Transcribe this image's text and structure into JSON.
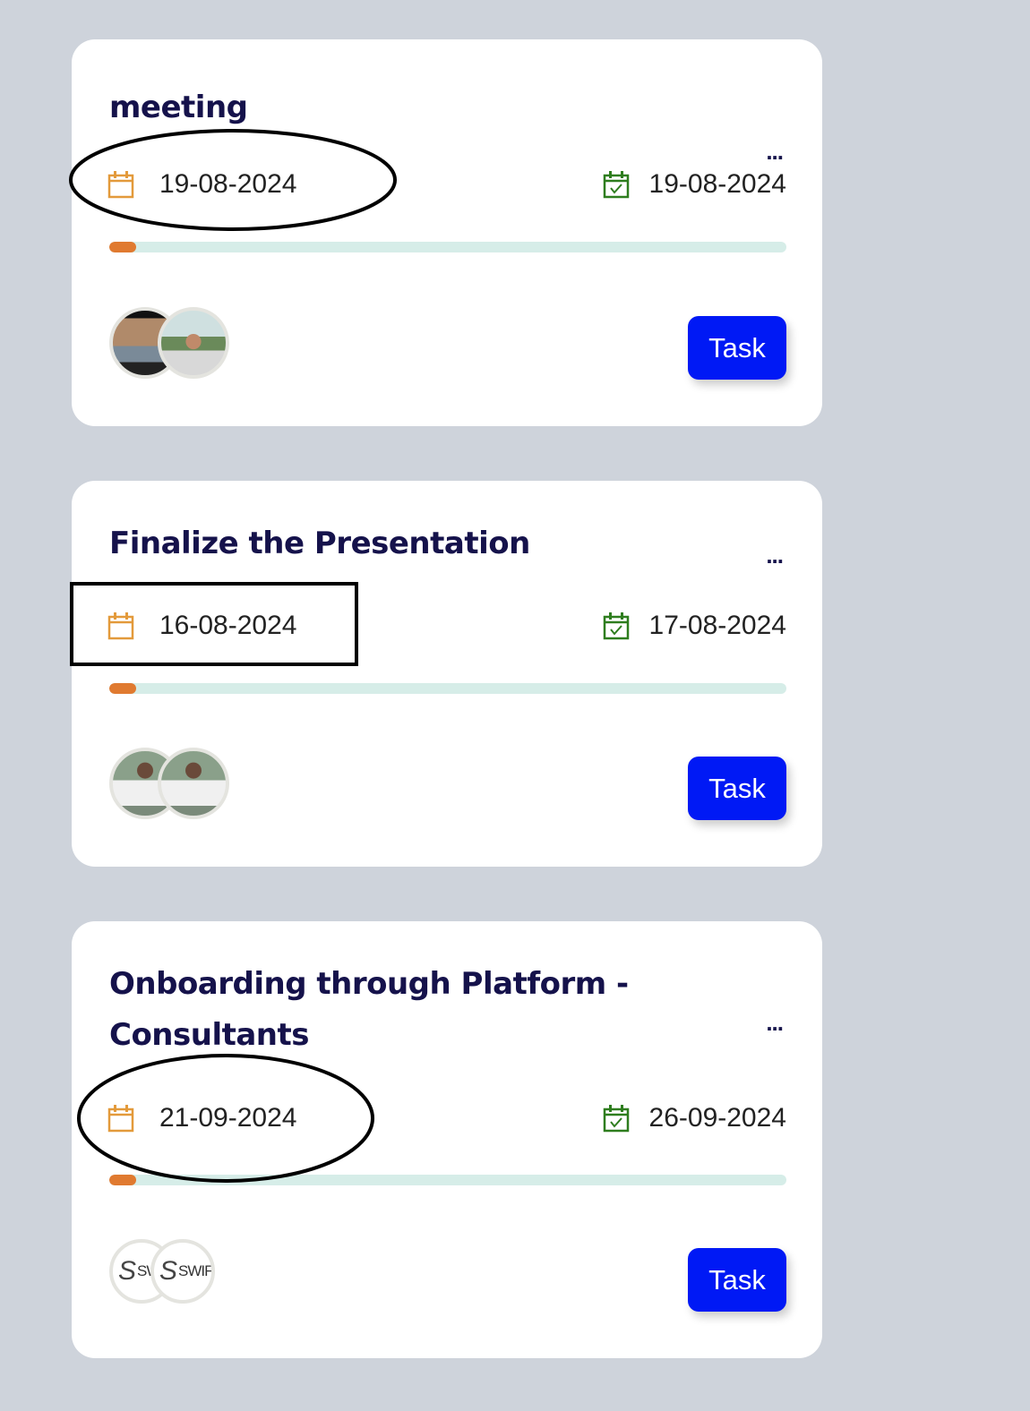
{
  "colors": {
    "title": "#15124b",
    "start_icon": "#e39a3b",
    "end_icon": "#2e7d1e",
    "progress_fill": "#e07a30",
    "progress_track": "#d6ede8",
    "task_button": "#0019f5",
    "background": "#ced3db"
  },
  "cards": [
    {
      "title": "meeting",
      "more": "...",
      "start_date": "19-08-2024",
      "end_date": "19-08-2024",
      "progress_percent": 4,
      "avatars": [
        "photo",
        "photo"
      ],
      "button": "Task",
      "annotation": "ellipse"
    },
    {
      "title": "Finalize the Presentation",
      "more": "...",
      "start_date": "16-08-2024",
      "end_date": "17-08-2024",
      "progress_percent": 4,
      "avatars": [
        "photo",
        "photo"
      ],
      "button": "Task",
      "annotation": "rectangle"
    },
    {
      "title": "Onboarding through Platform - Consultants",
      "more": "...",
      "start_date": "21-09-2024",
      "end_date": "26-09-2024",
      "progress_percent": 4,
      "avatars": [
        "SWIFTERZ logo",
        "SWIFTERZ logo"
      ],
      "button": "Task",
      "annotation": "ellipse"
    }
  ],
  "icons": {
    "start": "calendar-icon",
    "end": "calendar-check-icon",
    "more": "ellipsis-icon"
  }
}
